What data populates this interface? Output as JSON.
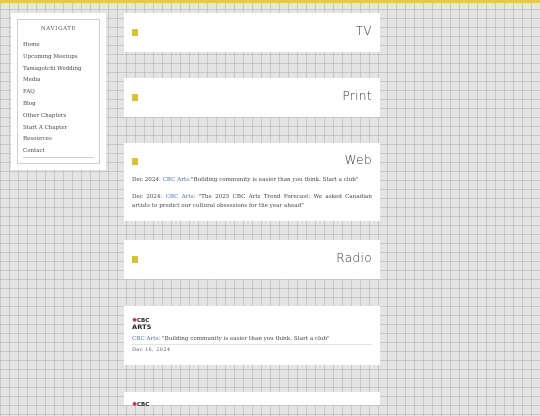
{
  "sidebar": {
    "title": "NAVIGATE",
    "items": [
      {
        "label": "Home"
      },
      {
        "label": "Upcoming Meetups"
      },
      {
        "label": "Tamagotchi Wedding"
      },
      {
        "label": "Media"
      },
      {
        "label": "FAQ"
      },
      {
        "label": "Blog"
      },
      {
        "label": "Other Chapters"
      },
      {
        "label": "Start A Chapter"
      },
      {
        "label": "Resources"
      },
      {
        "label": "Contact"
      }
    ]
  },
  "sections": {
    "tv": {
      "title": "TV"
    },
    "print": {
      "title": "Print"
    },
    "web": {
      "title": "Web",
      "entries": [
        {
          "date": "Dec 2024:",
          "source": "CBC Arts",
          "text": ":\"Building community is easier than you think. Start a club\""
        },
        {
          "date": "Dec 2024:",
          "source": "CBC Arts",
          "text": ": \"The 2025 CBC Arts Trend Forecast: We asked Canadian artists to predict our cultural obsessions for the year ahead\""
        }
      ]
    },
    "radio": {
      "title": "Radio"
    }
  },
  "articles": [
    {
      "logo_top": "CBC",
      "logo_bottom": "ARTS",
      "source": "CBC Arts",
      "text": ": \"Building community is easier than you think. Start a club\"",
      "date": "Dec 16, 2024"
    },
    {
      "logo_top": "CBC"
    }
  ],
  "colors": {
    "accent": "#d9c23a",
    "topbar": "#e6c84a",
    "link": "#4a6bb8",
    "cbc_red": "#c8102e"
  }
}
